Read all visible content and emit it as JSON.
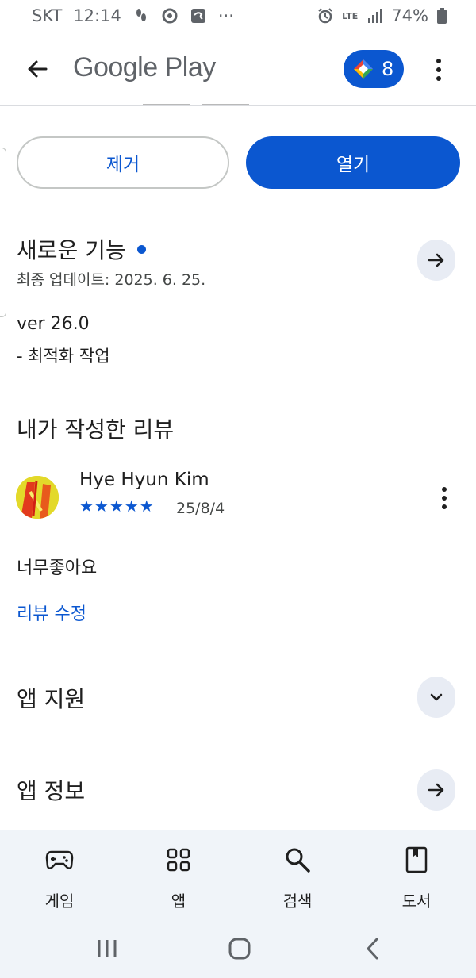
{
  "status_bar": {
    "carrier": "SKT",
    "time": "12:14",
    "more": "···",
    "network": "LTE",
    "battery": "74%"
  },
  "app_bar": {
    "title": "Google Play",
    "points": "8"
  },
  "actions": {
    "remove_label": "제거",
    "open_label": "열기"
  },
  "whats_new": {
    "title": "새로운 기능",
    "updated": "최종 업데이트: 2025. 6. 25.",
    "version": "ver 26.0",
    "change": "- 최적화 작업"
  },
  "my_review": {
    "heading": "내가 작성한 리뷰",
    "reviewer": "Hye Hyun Kim",
    "stars": "★★★★★",
    "rating": 5,
    "date": "25/8/4",
    "text": "너무좋아요",
    "edit_label": "리뷰 수정"
  },
  "sections": {
    "support": "앱 지원",
    "info": "앱 정보"
  },
  "bottom_nav": {
    "items": [
      {
        "label": "게임",
        "icon": "gamepad-icon"
      },
      {
        "label": "앱",
        "icon": "apps-grid-icon"
      },
      {
        "label": "검색",
        "icon": "search-icon"
      },
      {
        "label": "도서",
        "icon": "book-icon"
      }
    ]
  },
  "colors": {
    "primary": "#0b57d0",
    "nav_background": "#f0f4f9",
    "chip_background": "#e8ecf4"
  }
}
